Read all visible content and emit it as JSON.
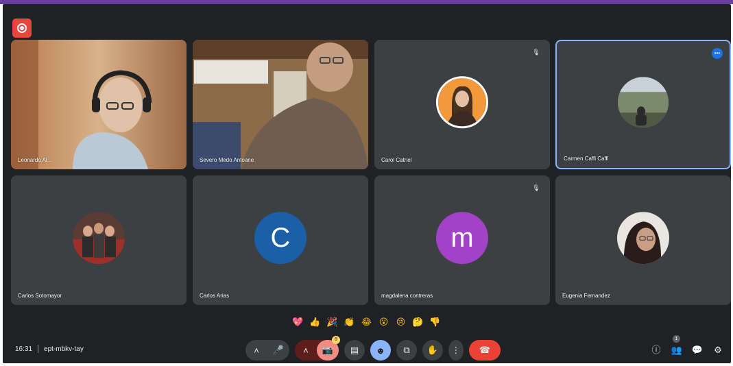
{
  "colors": {
    "accent": "#6b3fa0",
    "tile_bg": "#3c4043",
    "app_bg": "#202124",
    "hangup": "#ea4335"
  },
  "record_icon": "record-icon",
  "tiles": [
    {
      "name": "Leonardo Al...",
      "type": "video",
      "mic": ""
    },
    {
      "name": "Severo Medo Antoane",
      "type": "video",
      "mic": ""
    },
    {
      "name": "Carol Catriel",
      "type": "avatar-photo",
      "mic": "muted-mic-icon"
    },
    {
      "name": "Carmen Caffi Caffi",
      "type": "avatar-photo",
      "mic": "speaking-icon",
      "active": true
    },
    {
      "name": "Carlos Sotomayor",
      "type": "avatar-photo",
      "mic": ""
    },
    {
      "name": "Carlos Arias",
      "type": "letter",
      "letter": "C",
      "color": "#1a5fa8",
      "mic": ""
    },
    {
      "name": "magdalena contreras",
      "type": "letter",
      "letter": "m",
      "color": "#a142c7",
      "mic": "muted-mic-icon"
    },
    {
      "name": "Eugenia Fernandez",
      "type": "avatar-photo",
      "mic": ""
    }
  ],
  "reactions": [
    "💖",
    "👍",
    "🎉",
    "👏",
    "😂",
    "😮",
    "😢",
    "🤔",
    "👎"
  ],
  "meeting": {
    "time": "16:31",
    "code": "ept-mbkv-tay"
  },
  "controls": {
    "participant_count": "1",
    "hand_count": "8"
  }
}
